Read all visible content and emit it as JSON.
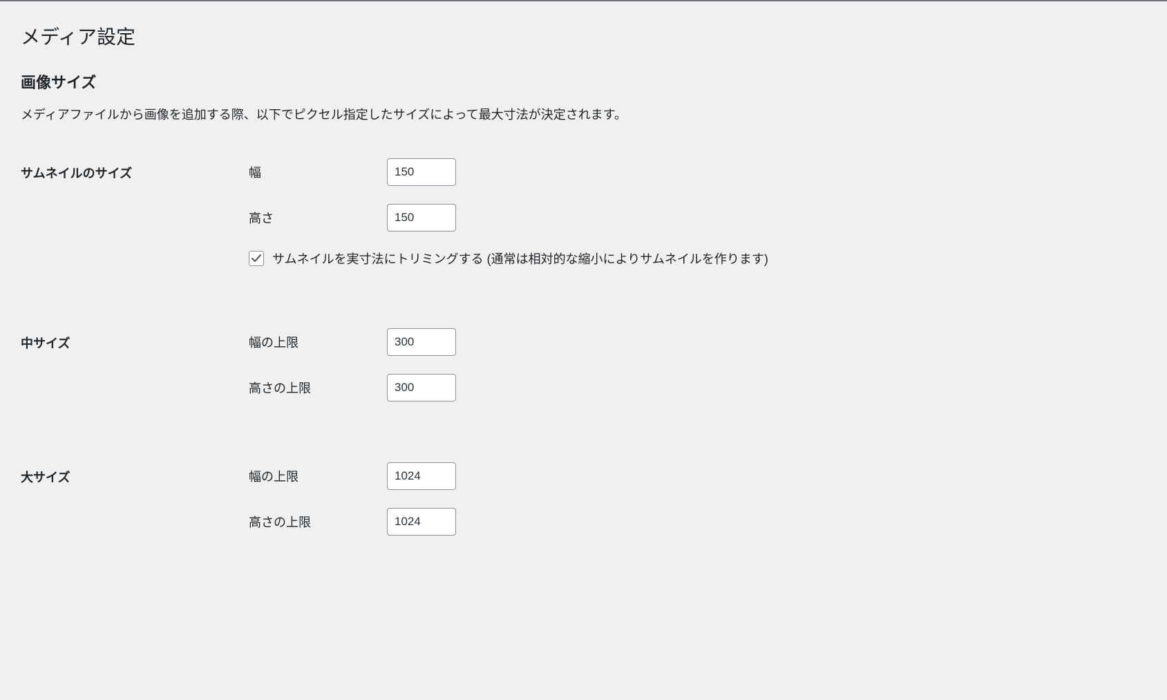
{
  "page": {
    "title": "メディア設定",
    "section_heading": "画像サイズ",
    "section_desc": "メディアファイルから画像を追加する際、以下でピクセル指定したサイズによって最大寸法が決定されます。"
  },
  "thumbnail": {
    "row_label": "サムネイルのサイズ",
    "width_label": "幅",
    "width_value": "150",
    "height_label": "高さ",
    "height_value": "150",
    "crop_checked": true,
    "crop_label": "サムネイルを実寸法にトリミングする (通常は相対的な縮小によりサムネイルを作ります)"
  },
  "medium": {
    "row_label": "中サイズ",
    "width_label": "幅の上限",
    "width_value": "300",
    "height_label": "高さの上限",
    "height_value": "300"
  },
  "large": {
    "row_label": "大サイズ",
    "width_label": "幅の上限",
    "width_value": "1024",
    "height_label": "高さの上限",
    "height_value": "1024"
  }
}
